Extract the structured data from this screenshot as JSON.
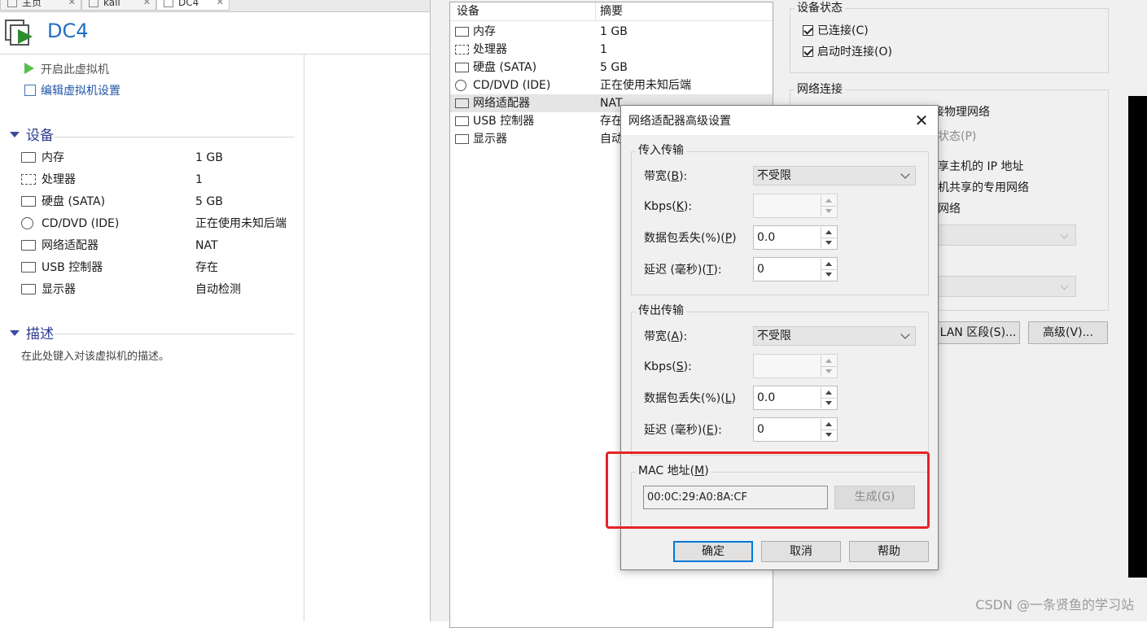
{
  "tabs": [
    {
      "label": "主页"
    },
    {
      "label": "kali"
    },
    {
      "label": "DC4"
    }
  ],
  "vm": {
    "title": "DC4",
    "actions": {
      "power_on": "开启此虚拟机",
      "edit_settings": "编辑虚拟机设置"
    },
    "devices_header": "设备",
    "devices": [
      {
        "name": "内存",
        "value": "1 GB"
      },
      {
        "name": "处理器",
        "value": "1"
      },
      {
        "name": "硬盘 (SATA)",
        "value": "5 GB"
      },
      {
        "name": "CD/DVD (IDE)",
        "value": "正在使用未知后端"
      },
      {
        "name": "网络适配器",
        "value": "NAT"
      },
      {
        "name": "USB 控制器",
        "value": "存在"
      },
      {
        "name": "显示器",
        "value": "自动检测"
      }
    ],
    "description_header": "描述",
    "description_placeholder": "在此处键入对该虚拟机的描述。"
  },
  "settings": {
    "hw_list": {
      "col_device": "设备",
      "col_summary": "摘要",
      "rows": [
        {
          "name": "内存",
          "value": "1 GB"
        },
        {
          "name": "处理器",
          "value": "1"
        },
        {
          "name": "硬盘 (SATA)",
          "value": "5 GB"
        },
        {
          "name": "CD/DVD (IDE)",
          "value": "正在使用未知后端"
        },
        {
          "name": "网络适配器",
          "value": "NAT"
        },
        {
          "name": "USB 控制器",
          "value": "存在"
        },
        {
          "name": "显示器",
          "value": "自动"
        }
      ]
    },
    "device_status": {
      "title": "设备状态",
      "connected": "已连接(C)",
      "connect_on_power_on": "启动时连接(O)"
    },
    "network": {
      "title": "网络连接",
      "frag_physical": "接物理网络",
      "frag_state": "状态(P)",
      "frag_host_ip": "享主机的 IP 地址",
      "frag_private": "机共享的专用网络",
      "frag_net": "网络"
    },
    "lan_segments_button": "LAN 区段(S)...",
    "advanced_button": "高级(V)..."
  },
  "dialog": {
    "title": "网络适配器高级设置",
    "close_symbol": "✕",
    "incoming": {
      "title": "传入传输",
      "bandwidth_label": "带宽(",
      "bandwidth_key": "B",
      "bandwidth_value": "不受限",
      "kbps_label": "Kbps(",
      "kbps_key": "K",
      "kbps_value": "",
      "loss_label": "数据包丢失(%)(",
      "loss_key": "P",
      "loss_value": "0.0",
      "latency_label": "延迟 (毫秒)(",
      "latency_key": "T",
      "latency_value": "0"
    },
    "outgoing": {
      "title": "传出传输",
      "bandwidth_label": "带宽(",
      "bandwidth_key": "A",
      "bandwidth_value": "不受限",
      "kbps_label": "Kbps(",
      "kbps_key": "S",
      "kbps_value": "",
      "loss_label": "数据包丢失(%)(",
      "loss_key": "L",
      "loss_value": "0.0",
      "latency_label": "延迟 (毫秒)(",
      "latency_key": "E",
      "latency_value": "0"
    },
    "label_close": "):",
    "mac": {
      "title_prefix": "MAC 地址(",
      "title_key": "M",
      "title_suffix": ")",
      "value": "00:0C:29:A0:8A:CF",
      "generate_label": "生成(G)"
    },
    "buttons": {
      "ok": "确定",
      "cancel": "取消",
      "help": "帮助"
    }
  },
  "watermark": "CSDN @一条贤鱼的学习站",
  "colors": {
    "title_blue": "#1f6fc5",
    "section_blue": "#2b3a8f",
    "highlight_red": "#e52424",
    "focus_blue": "#0078d7"
  }
}
